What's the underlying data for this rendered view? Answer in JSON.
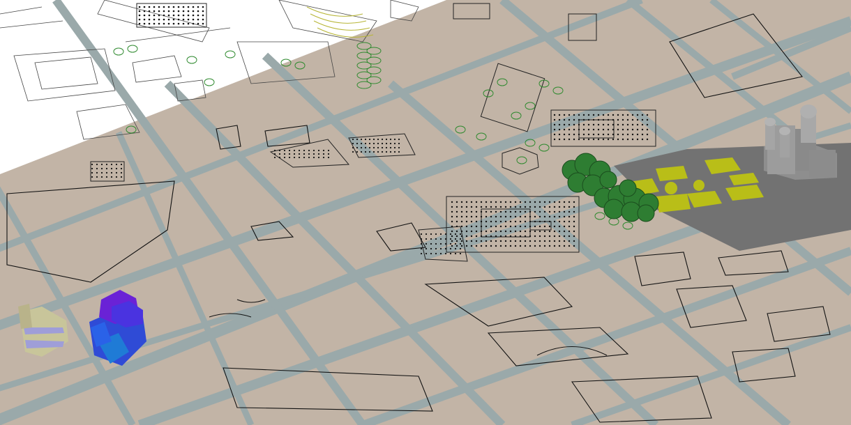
{
  "scene": {
    "palette": {
      "ground": "#c2b4a6",
      "street": "#9aa9aa",
      "white_area": "#ffffff",
      "plaza_gray": "#727272",
      "lawn_yellow": "#b9be18",
      "tree_green": "#2e7d32",
      "tree_ring": "#2f8a2f",
      "model_blue": "#2f4bd6",
      "model_purple": "#6a22d6",
      "model_beige": "#c8c59a",
      "tower_gray": "#9c9c9c"
    },
    "icons": [
      "3d-tower-model",
      "3d-colored-block-model",
      "tree-canopy-cluster",
      "tree-outline"
    ]
  }
}
